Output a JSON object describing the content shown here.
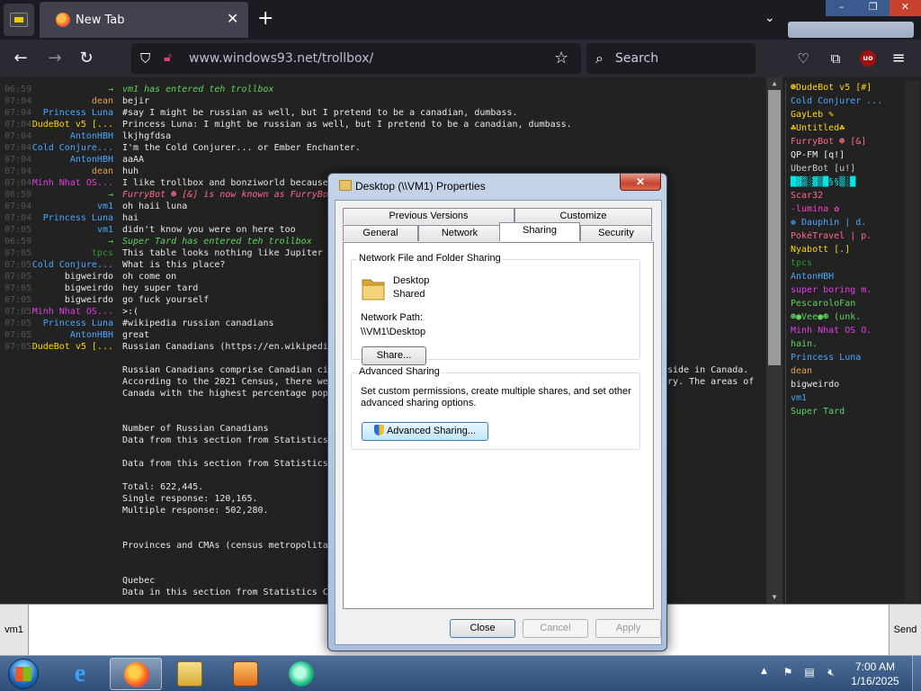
{
  "browser": {
    "tab_title": "New Tab",
    "url_host": "www.windows93.net",
    "url_path": "/trollbox/",
    "search_placeholder": "Search",
    "ublock_label": "uo"
  },
  "chat": [
    {
      "time": "06:59",
      "nick": "→",
      "nick_color": "#5fd35f",
      "msg": "vm1 has entered teh trollbox",
      "sys": true
    },
    {
      "time": "07:04",
      "nick": "dean",
      "nick_color": "#e0a050",
      "msg": "bejir"
    },
    {
      "time": "07:04",
      "nick": "Princess Luna",
      "nick_color": "#4aa8ff",
      "msg": "#say I might be russian as well, but I pretend to be a canadian, dumbass."
    },
    {
      "time": "07:04",
      "nick": "DudeBot v5 [...",
      "nick_color": "#ffd700",
      "msg": "Princess Luna: I might be russian as well, but I pretend to be a canadian, dumbass."
    },
    {
      "time": "07:04",
      "nick": "AntonHBH",
      "nick_color": "#4aa8ff",
      "msg": "lkjhgfdsa"
    },
    {
      "time": "07:04",
      "nick": "Cold Conjure...",
      "nick_color": "#4aa8ff",
      "msg": "I'm the Cold Conjurer... or Ember Enchanter."
    },
    {
      "time": "07:04",
      "nick": "AntonHBH",
      "nick_color": "#4aa8ff",
      "msg": "aaAA"
    },
    {
      "time": "07:04",
      "nick": "dean",
      "nick_color": "#e0a050",
      "msg": "huh"
    },
    {
      "time": "07:04",
      "nick": "Minh Nhat OS...",
      "nick_color": "#e040e0",
      "msg": "I like trollbox and bonziworld because"
    },
    {
      "time": "06:59",
      "nick": "→",
      "nick_color": "#5fd35f",
      "msg": "FurryBot ☻ [&] is now known as FurryBo",
      "sys": true,
      "msg_color": "#ff6a8a"
    },
    {
      "time": "07:04",
      "nick": "vm1",
      "nick_color": "#4aa8ff",
      "msg": "oh haii luna"
    },
    {
      "time": "07:04",
      "nick": "Princess Luna",
      "nick_color": "#4aa8ff",
      "msg": "hai"
    },
    {
      "time": "07:05",
      "nick": "vm1",
      "nick_color": "#4aa8ff",
      "msg": "didn't know you were on here too"
    },
    {
      "time": "06:59",
      "nick": "→",
      "nick_color": "#5fd35f",
      "msg": "Super Tard has entered teh trollbox",
      "sys": true
    },
    {
      "time": "07:05",
      "nick": "tpcs",
      "nick_color": "#2a9a2a",
      "msg": " This table looks nothing like Jupiter"
    },
    {
      "time": "07:05",
      "nick": "Cold Conjure...",
      "nick_color": "#4aa8ff",
      "msg": "What is this place?"
    },
    {
      "time": "07:05",
      "nick": "bigweirdo",
      "nick_color": "#e8e8e8",
      "msg": "oh come on"
    },
    {
      "time": "07:05",
      "nick": "bigweirdo",
      "nick_color": "#e8e8e8",
      "msg": "hey super tard"
    },
    {
      "time": "07:05",
      "nick": "bigweirdo",
      "nick_color": "#e8e8e8",
      "msg": "go fuck yourself"
    },
    {
      "time": "07:05",
      "nick": "Minh Nhat OS...",
      "nick_color": "#e040e0",
      "msg": ">:("
    },
    {
      "time": "07:05",
      "nick": "Princess Luna",
      "nick_color": "#4aa8ff",
      "msg": "#wikipedia russian canadians"
    },
    {
      "time": "07:05",
      "nick": "AntonHBH",
      "nick_color": "#4aa8ff",
      "msg": "great"
    },
    {
      "time": "07:05",
      "nick": "DudeBot v5 [...",
      "nick_color": "#ffd700",
      "msg": "Russian Canadians (https://en.wikipedi"
    }
  ],
  "article": [
    {
      "row": 24,
      "text": "Russian Canadians comprise Canadian ci",
      "tail": "side in Canada."
    },
    {
      "row": 25,
      "text": "According to the 2021 Census, there we",
      "tail": "ry. The areas of"
    },
    {
      "row": 26,
      "text": "Canada with the highest percentage pop"
    },
    {
      "row": 29,
      "text": "Number of Russian Canadians"
    },
    {
      "row": 30,
      "text": "Data from this section from Statistics"
    },
    {
      "row": 32,
      "text": "Data from this section from Statistics"
    },
    {
      "row": 34,
      "text": "Total: 622,445."
    },
    {
      "row": 35,
      "text": "Single response: 120,165."
    },
    {
      "row": 36,
      "text": "Multiple response: 502,280."
    },
    {
      "row": 39,
      "text": "Provinces and CMAs (census metropolita"
    },
    {
      "row": 42,
      "text": "Quebec"
    },
    {
      "row": 43,
      "text": "Data in this section from Statistics C"
    }
  ],
  "users": [
    {
      "name": "☻DudeBot v5 [#]",
      "color": "#ffd700"
    },
    {
      "name": "Cold Conjurer ...",
      "color": "#4aa8ff"
    },
    {
      "name": "GayLeb ✎",
      "color": "#ffd700"
    },
    {
      "name": "☘Untitled☘",
      "color": "#ffd700"
    },
    {
      "name": "FurryBot ☻ [&]",
      "color": "#ff6a8a"
    },
    {
      "name": "QP-FM [q!]",
      "color": "#f0f0f0"
    },
    {
      "name": "UberBot [u!]",
      "color": "#c8c8c8"
    },
    {
      "name": "█▓▒░▓▒█§§▒░█",
      "color": "#00e5e5"
    },
    {
      "name": "Scar32",
      "color": "#ff6a8a"
    },
    {
      "name": "-lumina ✿",
      "color": "#ff40c0"
    },
    {
      "name": "❁ Dauphin | d.",
      "color": "#4aa8ff"
    },
    {
      "name": "PokéTravel | p.",
      "color": "#ff6a8a"
    },
    {
      "name": "Nyabott [.]",
      "color": "#ffd700"
    },
    {
      "name": "tpcs",
      "color": "#2a9a2a"
    },
    {
      "name": "AntonHBH",
      "color": "#4aa8ff"
    },
    {
      "name": "super boring m.",
      "color": "#e040e0"
    },
    {
      "name": "PescaroloFan",
      "color": "#5fd35f"
    },
    {
      "name": "☻●Vee●☻ (unk.",
      "color": "#5fd35f"
    },
    {
      "name": "Minh Nhat OS O.",
      "color": "#e040e0"
    },
    {
      "name": "hain.",
      "color": "#5fd35f"
    },
    {
      "name": "Princess Luna",
      "color": "#4aa8ff"
    },
    {
      "name": "dean",
      "color": "#e0a050"
    },
    {
      "name": "bigweirdo",
      "color": "#e8e8e8"
    },
    {
      "name": "vm1",
      "color": "#4aa8ff"
    },
    {
      "name": "Super Tard",
      "color": "#5fd35f"
    }
  ],
  "input": {
    "nick": "vm1",
    "send_label": "Send"
  },
  "dialog": {
    "title": "Desktop (\\\\VM1) Properties",
    "close_glyph": "✕",
    "tabs_top": [
      "Previous Versions",
      "Customize"
    ],
    "tabs_bottom": [
      "General",
      "Network",
      "Sharing",
      "Security"
    ],
    "active_tab": "Sharing",
    "nffs_title": "Network File and Folder Sharing",
    "folder_name": "Desktop",
    "folder_state": "Shared",
    "network_path_label": "Network Path:",
    "network_path": "\\\\VM1\\Desktop",
    "share_button": "Share...",
    "adv_title": "Advanced Sharing",
    "adv_desc_1": "Set custom permissions, create multiple shares, and set other",
    "adv_desc_2": "advanced sharing options.",
    "adv_button": "Advanced Sharing...",
    "close_button": "Close",
    "cancel_button": "Cancel",
    "apply_button": "Apply"
  },
  "taskbar": {
    "time": "7:00 AM",
    "date": "1/16/2025"
  }
}
